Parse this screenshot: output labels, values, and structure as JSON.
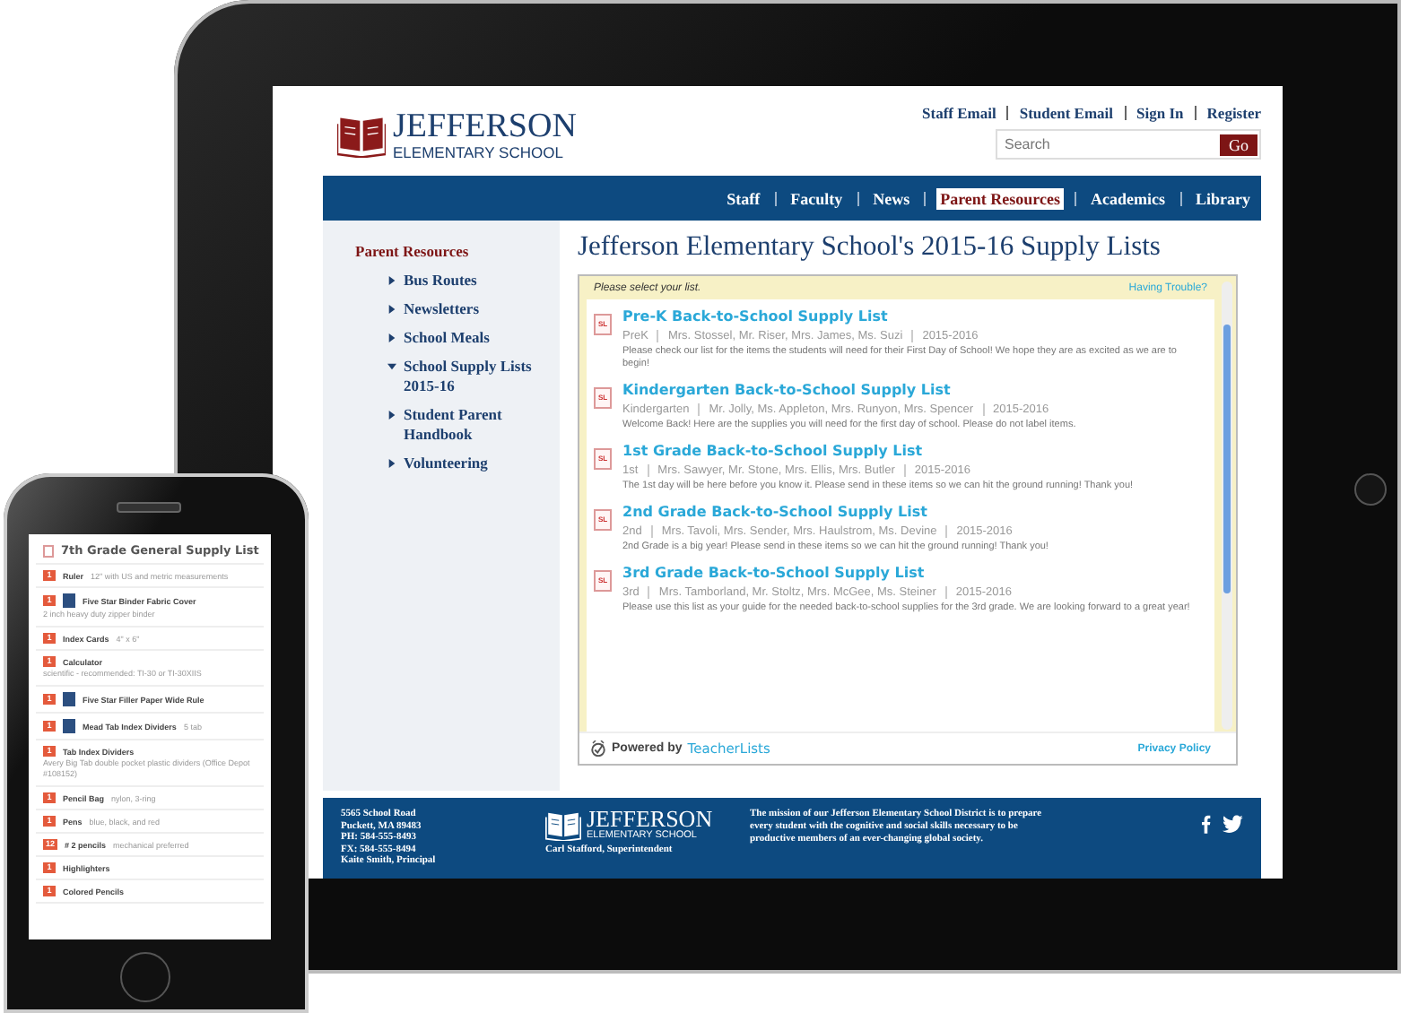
{
  "tablet": {
    "header": {
      "logo_title": "JEFFERSON",
      "logo_subtitle": "ELEMENTARY SCHOOL",
      "top_links": [
        "Staff Email",
        "Student Email",
        "Sign In",
        "Register"
      ],
      "search": {
        "placeholder": "Search",
        "button": "Go"
      }
    },
    "nav": [
      {
        "label": "Staff",
        "selected": false
      },
      {
        "label": "Faculty",
        "selected": false
      },
      {
        "label": "News",
        "selected": false
      },
      {
        "label": "Parent Resources",
        "selected": true
      },
      {
        "label": "Academics",
        "selected": false
      },
      {
        "label": "Library",
        "selected": false
      }
    ],
    "sidebar": {
      "title": "Parent Resources",
      "items": [
        {
          "label": "Bus Routes",
          "expanded": false
        },
        {
          "label": "Newsletters",
          "expanded": false
        },
        {
          "label": "School Meals",
          "expanded": false
        },
        {
          "label": "School Supply Lists 2015-16",
          "expanded": true
        },
        {
          "label": "Student Parent Handbook",
          "expanded": false
        },
        {
          "label": "Volunteering",
          "expanded": false
        }
      ]
    },
    "page_title": "Jefferson Elementary School's 2015-16 Supply Lists",
    "widget": {
      "prompt": "Please select your list.",
      "help_link": "Having Trouble?",
      "lists": [
        {
          "icon_label": "SL",
          "title": "Pre-K Back-to-School Supply List",
          "grade": "PreK",
          "teachers": "Mrs. Stossel, Mr. Riser, Mrs. James, Ms. Suzi",
          "year": "2015-2016",
          "description": "Please check our list for the items the students will need for their First Day of School! We hope they are as excited as we are to begin!"
        },
        {
          "icon_label": "SL",
          "title": "Kindergarten Back-to-School Supply List",
          "grade": "Kindergarten",
          "teachers": "Mr. Jolly, Ms. Appleton, Mrs. Runyon, Mrs. Spencer",
          "year": "2015-2016",
          "description": "Welcome Back! Here are the supplies you will need for the first day of school. Please do not label items."
        },
        {
          "icon_label": "SL",
          "title": "1st Grade Back-to-School Supply List",
          "grade": "1st",
          "teachers": "Mrs. Sawyer, Mr. Stone, Mrs. Ellis, Mrs. Butler",
          "year": "2015-2016",
          "description": "The 1st day will be here before you know it. Please send in these items so we can hit the ground running! Thank you!"
        },
        {
          "icon_label": "SL",
          "title": "2nd Grade Back-to-School Supply List",
          "grade": "2nd",
          "teachers": "Mrs. Tavoli, Mrs. Sender, Mrs. Haulstrom, Ms. Devine",
          "year": "2015-2016",
          "description": "2nd Grade is a big year! Please send in these items so we can hit the ground running! Thank you!"
        },
        {
          "icon_label": "SL",
          "title": "3rd Grade Back-to-School Supply List",
          "grade": "3rd",
          "teachers": "Mrs. Tamborland, Mr. Stoltz, Mrs. McGee, Ms. Steiner",
          "year": "2015-2016",
          "description": "Please use this list as your guide for the needed back-to-school supplies for the 3rd grade. We are looking forward to a great year!"
        }
      ],
      "powered_by": "Powered by",
      "brand": "TeacherLists",
      "privacy_link": "Privacy Policy"
    },
    "footer": {
      "address": [
        "5565 School Road",
        "Puckett, MA 89483",
        "PH: 584-555-8493",
        "FX: 584-555-8494",
        "Kaite Smith, Principal"
      ],
      "logo_title": "JEFFERSON",
      "logo_subtitle": "ELEMENTARY SCHOOL",
      "superintendent": "Carl Stafford, Superintendent",
      "mission": "The mission of our Jefferson Elementary School District is to prepare every student with the cognitive and social skills necessary to be productive members of an ever-changing global society."
    }
  },
  "phone": {
    "title": "7th Grade General Supply List",
    "items": [
      {
        "qty": "1",
        "name": "Ruler",
        "note": "12\" with US and metric measurements",
        "image": false
      },
      {
        "qty": "1",
        "name": "Five Star Binder Fabric Cover",
        "image": true,
        "detail": "2 inch heavy duty zipper binder"
      },
      {
        "qty": "1",
        "name": "Index Cards",
        "note": "4\" x 6\"",
        "image": false
      },
      {
        "qty": "1",
        "name": "Calculator",
        "image": false,
        "detail": "scientific - recommended: TI-30 or TI-30XIIS"
      },
      {
        "qty": "1",
        "name": "Five Star Filler Paper Wide Rule",
        "image": true
      },
      {
        "qty": "1",
        "name": "Mead Tab Index Dividers",
        "note": "5 tab",
        "image": true
      },
      {
        "qty": "1",
        "name": "Tab Index Dividers",
        "image": false,
        "detail": "Avery Big Tab double pocket plastic dividers (Office Depot #108152)"
      },
      {
        "qty": "1",
        "name": "Pencil Bag",
        "note": "nylon, 3-ring",
        "image": false
      },
      {
        "qty": "1",
        "name": "Pens",
        "note": "blue, black, and red",
        "image": false
      },
      {
        "qty": "12",
        "name": "# 2 pencils",
        "note": "mechanical preferred",
        "image": false
      },
      {
        "qty": "1",
        "name": "Highlighters",
        "image": false
      },
      {
        "qty": "1",
        "name": "Colored Pencils",
        "image": false
      }
    ]
  }
}
